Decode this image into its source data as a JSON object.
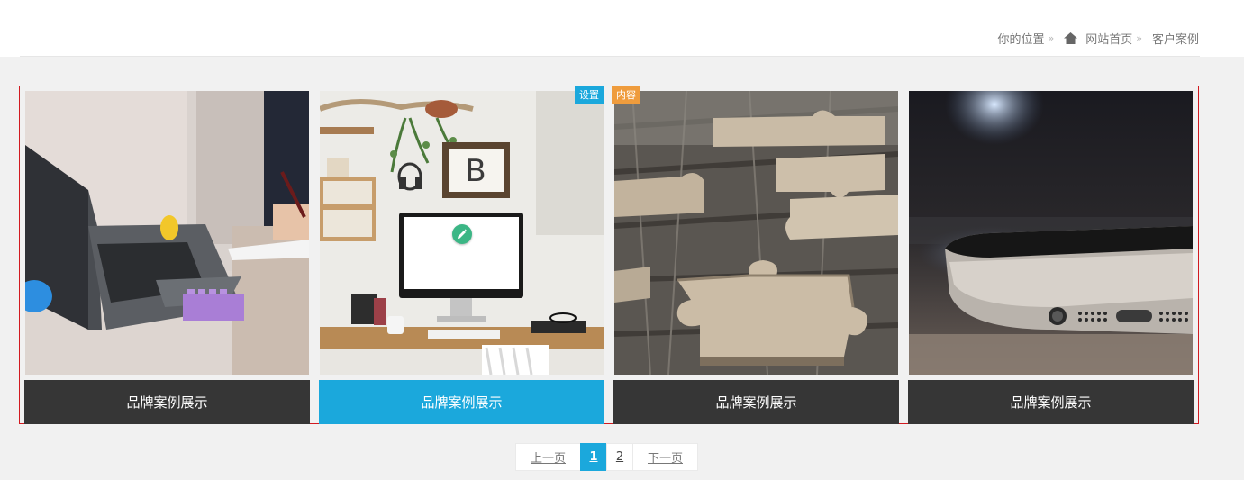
{
  "breadcrumb": {
    "label": "你的位置",
    "separator": "»",
    "home": "网站首页",
    "current": "客户案例"
  },
  "cases": [
    {
      "title": "品牌案例展示",
      "image": "laptop-on-sofa"
    },
    {
      "title": "品牌案例展示",
      "image": "desk-with-monitor"
    },
    {
      "title": "品牌案例展示",
      "image": "puzzle-pieces"
    },
    {
      "title": "品牌案例展示",
      "image": "smartphone-closeup"
    }
  ],
  "editor_tags": {
    "settings": "设置",
    "content": "内容"
  },
  "pagination": {
    "prev": "上一页",
    "pages": [
      "1",
      "2"
    ],
    "current": "1",
    "next": "下一页"
  },
  "colors": {
    "accent": "#1ba8dc",
    "caption_dark": "#363636",
    "border_red": "#d21a20",
    "tag_orange": "#ef9c3d",
    "edit_green": "#3bb685"
  },
  "icons": [
    "home-icon",
    "pencil-icon"
  ]
}
